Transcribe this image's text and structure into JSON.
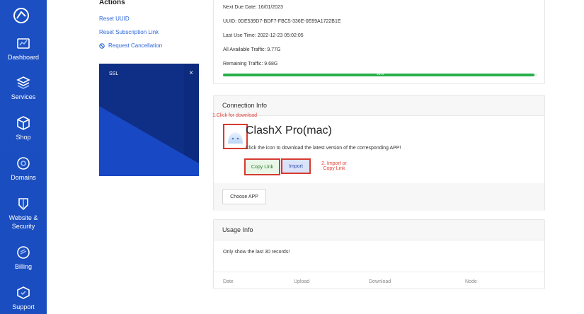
{
  "sidebar": {
    "items": [
      {
        "label": "Dashboard",
        "icon": "dashboard-icon"
      },
      {
        "label": "Services",
        "icon": "services-icon"
      },
      {
        "label": "Shop",
        "icon": "shop-icon"
      },
      {
        "label": "Domains",
        "icon": "domains-icon"
      },
      {
        "label": "Website &",
        "label2": "Security",
        "icon": "website-security-icon"
      },
      {
        "label": "Billing",
        "icon": "billing-icon"
      },
      {
        "label": "Support",
        "icon": "support-icon"
      }
    ]
  },
  "actions": {
    "title": "Actions",
    "reset_uuid": "Reset UUID",
    "reset_subscription": "Reset Subscription Link",
    "request_cancellation": "Request Cancellation"
  },
  "ssl_card": {
    "title": "SSL",
    "close": "×"
  },
  "subscription": {
    "next_due": "Next Due Date: 16/01/2023",
    "uuid": "UUID: 0DE539D7-BDF7-FBC5-336E-0E89A1722B1E",
    "last_use": "Last Use Time: 2022-12-23 05:02:05",
    "all_traffic": "All Available Traffic: 9.77G",
    "remaining": "Remaining Traffic: 9.68G",
    "progress_label": "99%",
    "progress_fraction": 0.99
  },
  "connection": {
    "title": "Connection Info",
    "annot_click": "1.Click for download",
    "app_name": "ClashX Pro(mac)",
    "app_desc": "Click the icon to download the latest version of the corresponding APP!",
    "copy_link": "Copy Link",
    "import": "Import",
    "annot_import_1": "2. Import or",
    "annot_import_2": "Copy Link",
    "choose_app": "Choose APP"
  },
  "usage": {
    "title": "Usage Info",
    "note": "Only show the last 30 records!",
    "columns": [
      "Date",
      "Upload",
      "Download",
      "Node"
    ]
  },
  "colors": {
    "sidebar": "#1b4fc2",
    "accent": "#2c67d9",
    "progress": "#28b04b",
    "annotation": "#d63b2f"
  }
}
